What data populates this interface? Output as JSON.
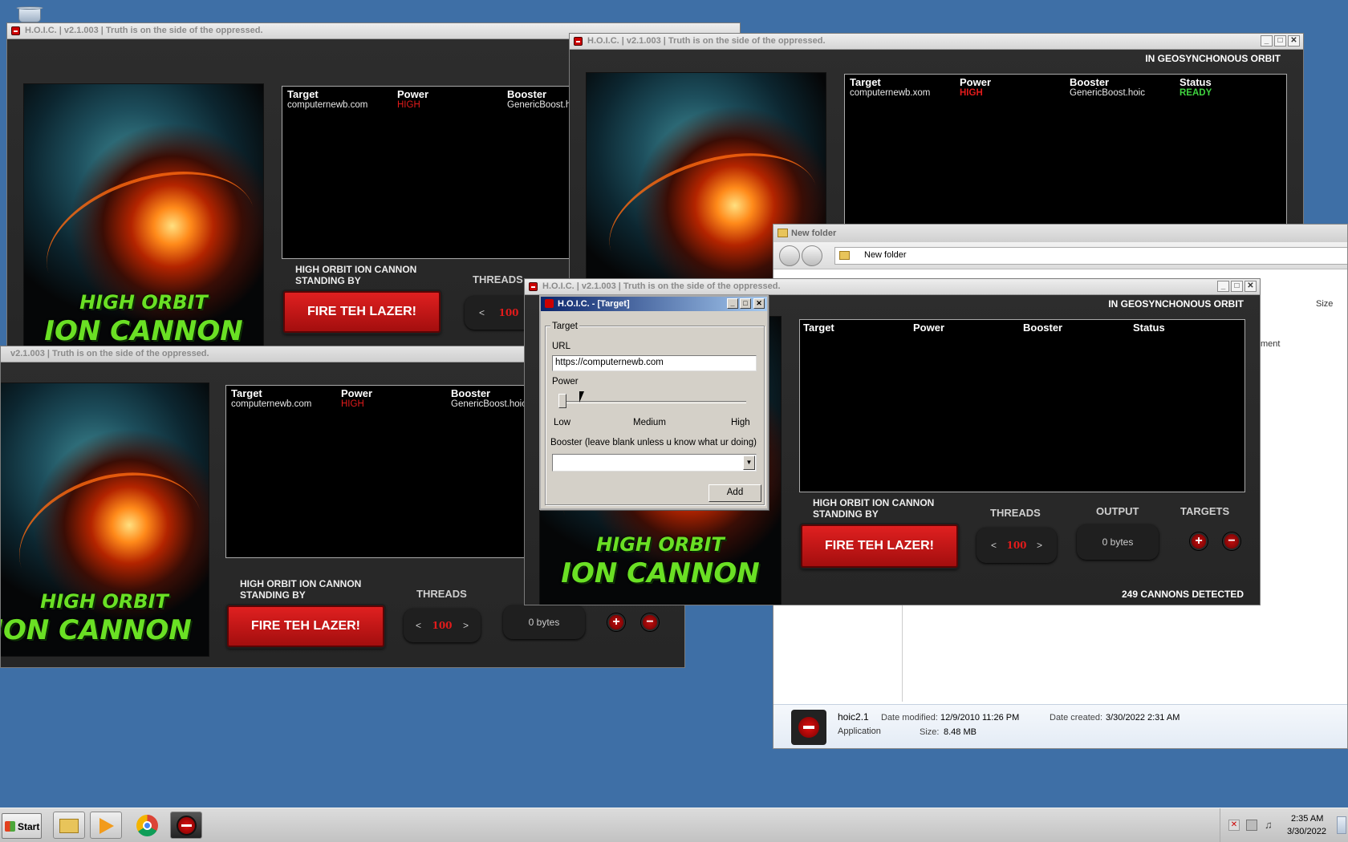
{
  "desktop": {
    "recycle_icon": "recycle-bin-icon"
  },
  "hoic": {
    "title": "H.O.I.C. | v2.1.003 | Truth is on the side of the oppressed.",
    "title_truncated": "v2.1.003 | Truth is on the side of the oppressed.",
    "logo_line1": "HIGH ORBIT",
    "logo_line2": "ION CANNON",
    "cols": {
      "target": "Target",
      "power": "Power",
      "booster": "Booster",
      "status": "Status"
    },
    "status_line1": "HIGH ORBIT ION CANNON",
    "status_line2": "STANDING BY",
    "orbit": "IN GEOSYNCHONOUS ORBIT",
    "threads_label": "THREADS",
    "output_label": "OUTPUT",
    "targets_label": "TARGETS",
    "fire_label": "FIRE TEH LAZER!",
    "threads_value": "100",
    "prev": "<",
    "next": ">",
    "output_value": "0 bytes",
    "plus": "+",
    "minus": "−",
    "detected": "249 CANNONS DETECTED",
    "win_ctl": {
      "min": "_",
      "max": "□",
      "close": "✕"
    },
    "win1_row": {
      "target": "computernewb.com",
      "power": "HIGH",
      "booster": "GenericBoost.hoic"
    },
    "win2_row": {
      "target": "computernewb.xom",
      "power": "HIGH",
      "booster": "GenericBoost.hoic",
      "status": "READY"
    },
    "win3_row": {
      "target": "computernewb.com",
      "power": "HIGH",
      "booster": "GenericBoost.hoic"
    }
  },
  "dialog": {
    "title": "H.O.I.C. - [Target]",
    "group": "Target",
    "url_label": "URL",
    "url_value": "https://computernewb.com",
    "power_label": "Power",
    "power_level": 0,
    "low": "Low",
    "medium": "Medium",
    "high": "High",
    "booster_label": "Booster (leave blank unless u know what ur doing)",
    "booster_value": "",
    "add": "Add",
    "dropdown_arrow": "▼"
  },
  "explorer": {
    "title": "New folder",
    "breadcrumb": "New folder",
    "col_size": "Size",
    "partial_text": "ment",
    "file_name": "hoic2.1",
    "file_type": "Application",
    "modified_label": "Date modified:",
    "modified": "12/9/2010 11:26 PM",
    "created_label": "Date created:",
    "created": "3/30/2022 2:31 AM",
    "size_label": "Size:",
    "size": "8.48 MB"
  },
  "taskbar": {
    "start": "Start",
    "time": "2:35 AM",
    "date": "3/30/2022",
    "items": [
      "explorer-icon",
      "media-player-icon",
      "chrome-icon",
      "hoic-icon"
    ]
  }
}
